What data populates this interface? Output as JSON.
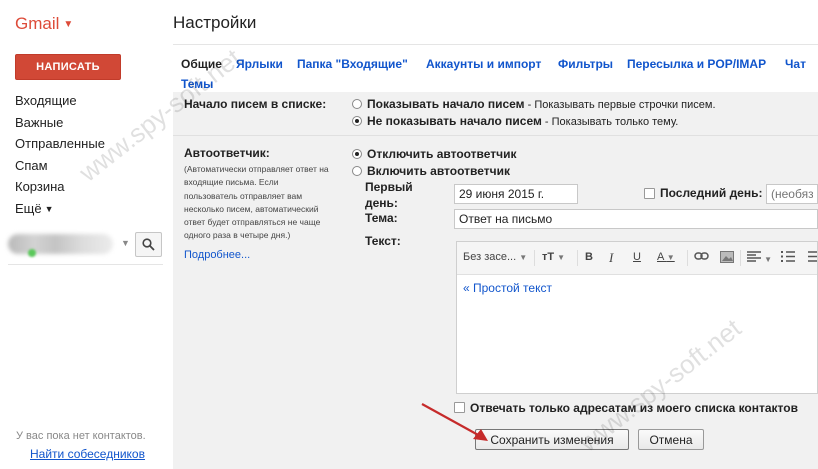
{
  "app": {
    "brand": "Gmail",
    "page_title": "Настройки"
  },
  "left": {
    "compose": "НАПИСАТЬ",
    "nav": [
      "Входящие",
      "Важные",
      "Отправленные",
      "Спам",
      "Корзина",
      "Ещё"
    ],
    "no_contacts": "У вас пока нет контактов.",
    "find_people": "Найти собеседников"
  },
  "tabs": [
    "Общие",
    "Ярлыки",
    "Папка \"Входящие\"",
    "Аккаунты и импорт",
    "Фильтры",
    "Пересылка и POP/IMAP",
    "Чат",
    "Темы"
  ],
  "snippets": {
    "label": "Начало писем в списке:",
    "show_bold": "Показывать начало писем",
    "show_desc": " - Показывать первые строчки писем.",
    "hide_bold": "Не показывать начало писем",
    "hide_desc": " - Показывать только тему.",
    "selected": "hide"
  },
  "autoresponder": {
    "label": "Автоответчик:",
    "hint": "(Автоматически отправляет ответ на входящие письма. Если пользователь отправляет вам несколько писем, автоматический ответ будет отправляться не чаще одного раза в четыре дня.)",
    "more": "Подробнее...",
    "off": "Отключить автоответчик",
    "on": "Включить автоответчик",
    "selected": "off",
    "first_day_label": "Первый день:",
    "first_day_value": "29 июня 2015 г.",
    "last_day_label": "Последний день:",
    "last_day_placeholder": "(необяза",
    "subject_label": "Тема:",
    "subject_value": "Ответ на письмо",
    "body_label": "Текст:",
    "font_select": "Без засе...",
    "plain_text": "« Простой текст",
    "contacts_only": "Отвечать только адресатам из моего списка контактов"
  },
  "actions": {
    "save": "Сохранить изменения",
    "cancel": "Отмена"
  },
  "watermark": "www.spy-soft.net",
  "colors": {
    "brand_red": "#dd4b39",
    "compose_bg": "#d14836",
    "link": "#1155cc",
    "arrow": "#c62b2b"
  }
}
